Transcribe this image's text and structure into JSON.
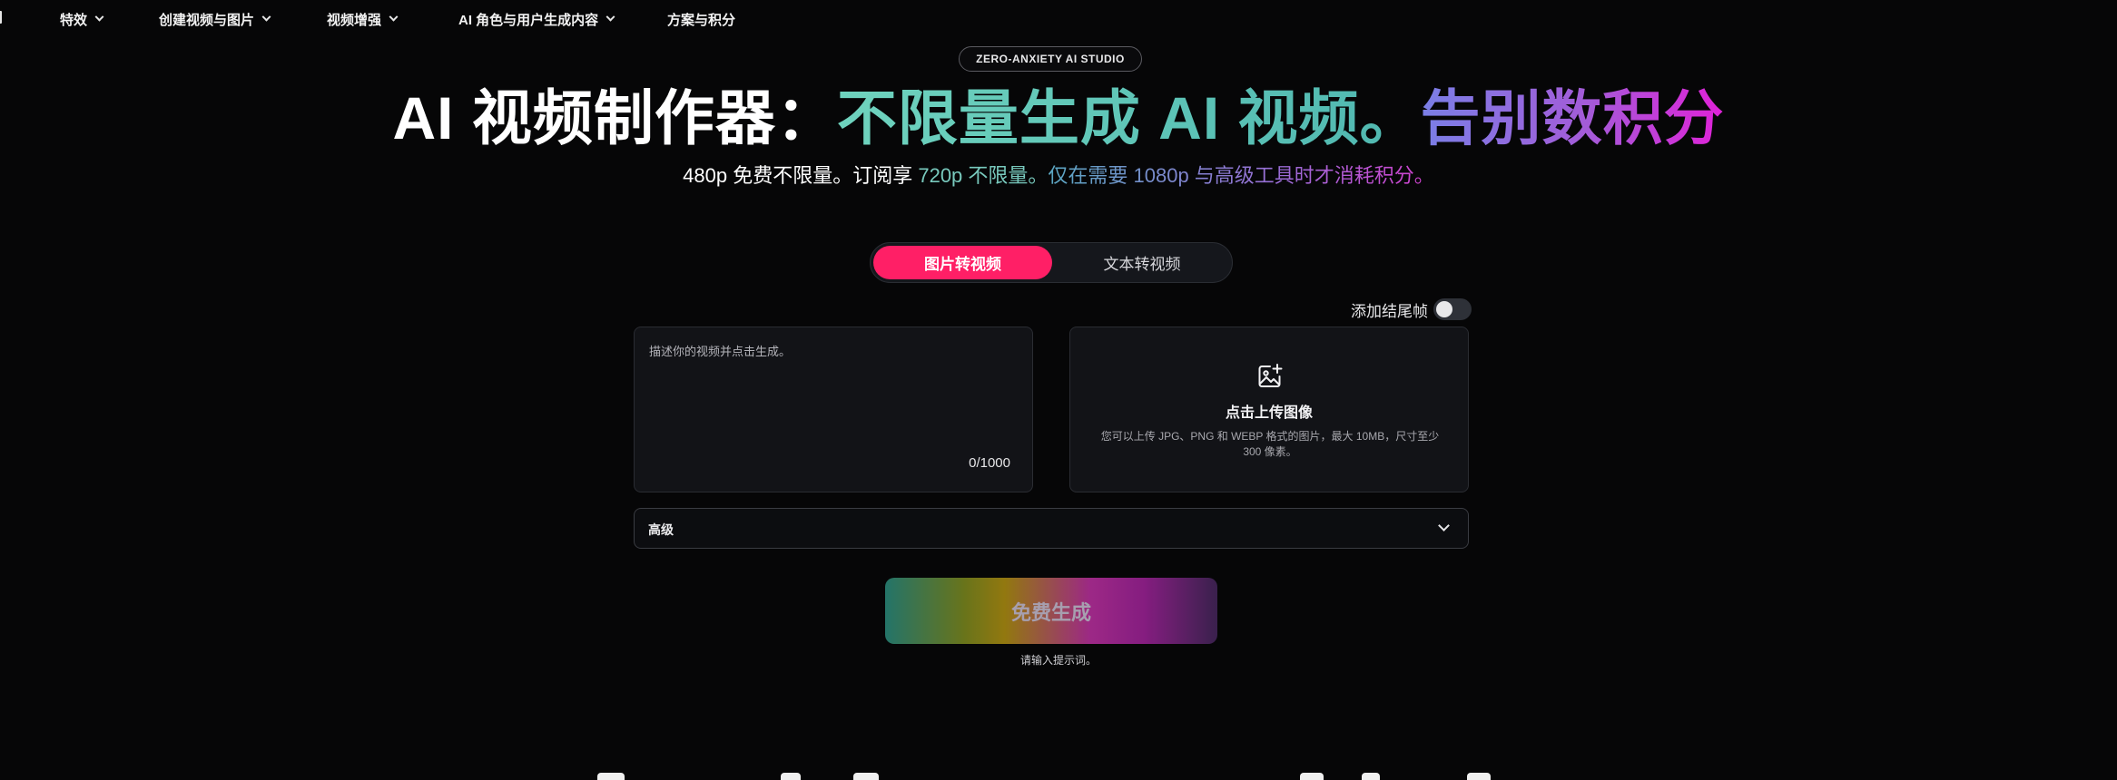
{
  "nav": {
    "items": [
      {
        "label": "特效",
        "has_dropdown": true
      },
      {
        "label": "创建视频与图片",
        "has_dropdown": true
      },
      {
        "label": "视频增强",
        "has_dropdown": true
      },
      {
        "label": "AI 角色与用户生成内容",
        "has_dropdown": true
      },
      {
        "label": "方案与积分",
        "has_dropdown": false
      }
    ]
  },
  "hero": {
    "badge": "ZERO-ANXIETY AI STUDIO",
    "headline": {
      "part1": "AI 视频制作器：",
      "part2": "不限量生成 AI 视频。",
      "part3": "告别数积分"
    },
    "subline": {
      "part1": "480p 免费不限量。订阅享 ",
      "part2": "720p 不限量。",
      "part3": "仅在需要 1080p 与高级工具时才消耗积分。"
    }
  },
  "mode_toggle": {
    "active": "图片转视频",
    "inactive": "文本转视频"
  },
  "end_frame": {
    "label": "添加结尾帧",
    "enabled": false
  },
  "prompt": {
    "placeholder": "描述你的视频并点击生成。",
    "value": "",
    "char_count": "0/1000"
  },
  "upload": {
    "icon": "image-plus-icon",
    "title": "点击上传图像",
    "description": "您可以上传 JPG、PNG 和 WEBP 格式的图片，最大 10MB，尺寸至少 300 像素。"
  },
  "advanced": {
    "label": "高级",
    "icon": "chevron-down-icon"
  },
  "generate": {
    "label": "免费生成",
    "hint": "请输入提示词。"
  },
  "colors": {
    "background": "#060607",
    "accent_pink": "#ff1f66",
    "teal": "#6fd3be",
    "magenta": "#e021d8"
  }
}
